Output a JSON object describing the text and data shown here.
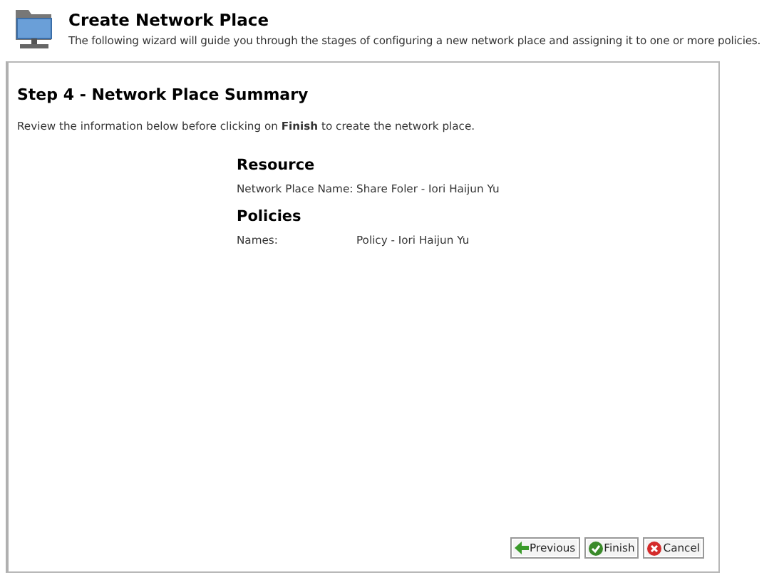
{
  "header": {
    "title": "Create Network Place",
    "subtitle": "The following wizard will guide you through the stages of configuring a new network place and assigning it to one or more policies."
  },
  "step": {
    "title": "Step 4 - Network Place Summary",
    "instruction": "Review the information below before clicking on **Finish** to create the network place."
  },
  "sections": [
    {
      "heading": "Resource",
      "rows": [
        {
          "label": "Network Place Name:",
          "value": "Share Foler - Iori Haijun Yu"
        }
      ]
    },
    {
      "heading": "Policies",
      "rows": [
        {
          "label": "Names:",
          "value": "Policy - Iori Haijun Yu"
        }
      ]
    }
  ],
  "buttons": [
    {
      "kind": "previous",
      "label": "Previous"
    },
    {
      "kind": "finish",
      "label": "Finish"
    },
    {
      "kind": "cancel",
      "label": "Cancel"
    }
  ]
}
